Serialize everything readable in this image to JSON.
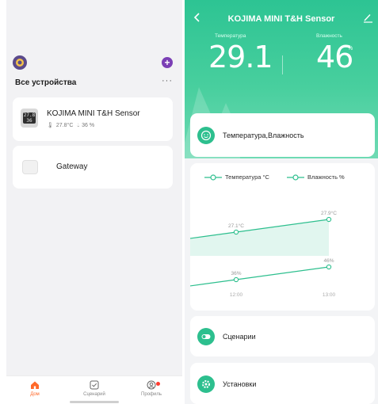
{
  "home": {
    "title": "Все устройства",
    "more": "···",
    "add": "+",
    "devices": [
      {
        "name": "KOJIMA MINI T&H Sensor",
        "temp": "27.8°C",
        "humidity": "36 %",
        "screen_text": "27.8 36"
      },
      {
        "name": "Gateway"
      }
    ],
    "tabs": [
      {
        "label": "Дом",
        "icon": "home-icon",
        "active": true
      },
      {
        "label": "Сценарий",
        "icon": "scene-icon",
        "active": false
      },
      {
        "label": "Профиль",
        "icon": "profile-icon",
        "active": false
      }
    ]
  },
  "detail": {
    "title": "KOJIMA MINI T&H Sensor",
    "temp_label": "Температура",
    "hum_label": "Влажность",
    "temp_value": "29.1",
    "temp_unit": "°C",
    "hum_value": "46",
    "hum_unit": "%",
    "summary_label": "Температура,Влажность",
    "scenarios_label": "Сценарии",
    "settings_label": "Установки"
  },
  "colors": {
    "accent": "#2dc493",
    "home_tab_active": "#ff6a2b",
    "add_button": "#7b3fb5"
  },
  "chart_data": {
    "type": "line",
    "x": [
      "12:00",
      "13:00"
    ],
    "series": [
      {
        "name": "Температура °C",
        "values": [
          27.1,
          27.9
        ],
        "labels": [
          "27.1°C",
          "27.9°C"
        ]
      },
      {
        "name": "Влажность %",
        "values": [
          36,
          46
        ],
        "labels": [
          "36%",
          "46%"
        ]
      }
    ],
    "legend": [
      "Температура °C",
      "Влажность %"
    ],
    "legend_position": "top"
  }
}
